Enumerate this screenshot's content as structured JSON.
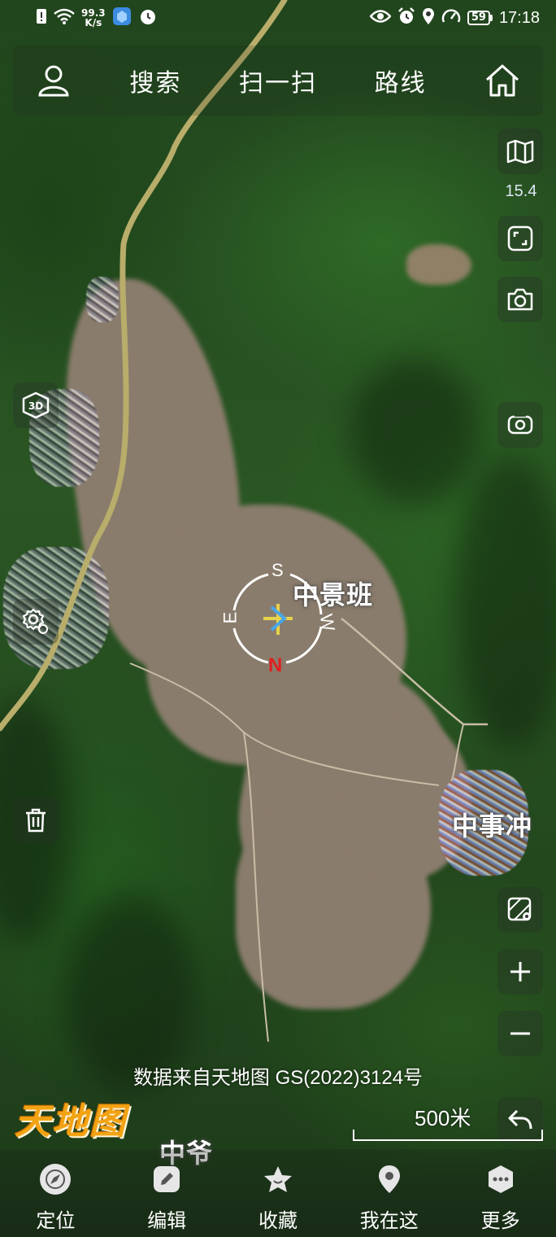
{
  "status_bar": {
    "net_speed_value": "99.3",
    "net_speed_unit": "K/s",
    "battery": "59",
    "time": "17:18"
  },
  "top_nav": {
    "search": "搜索",
    "scan": "扫一扫",
    "route": "路线"
  },
  "map": {
    "zoom_level": "15.4",
    "compass": {
      "s": "S",
      "e": "E",
      "w": "W",
      "n": "N"
    },
    "places": [
      {
        "name": "中景班"
      },
      {
        "name": "中事冲"
      },
      {
        "name": "中爷"
      }
    ],
    "attribution": "数据来自天地图 GS(2022)3124号",
    "brand": "天地图",
    "scale": "500米"
  },
  "bottom_nav": {
    "items": [
      {
        "label": "定位",
        "icon": "compass-icon"
      },
      {
        "label": "编辑",
        "icon": "edit-icon"
      },
      {
        "label": "收藏",
        "icon": "star-icon"
      },
      {
        "label": "我在这",
        "icon": "location-pin-icon"
      },
      {
        "label": "更多",
        "icon": "more-icon"
      }
    ]
  },
  "colors": {
    "compass_red": "#e02020",
    "road": "#b8ad6a",
    "brand": "#f2a314"
  }
}
